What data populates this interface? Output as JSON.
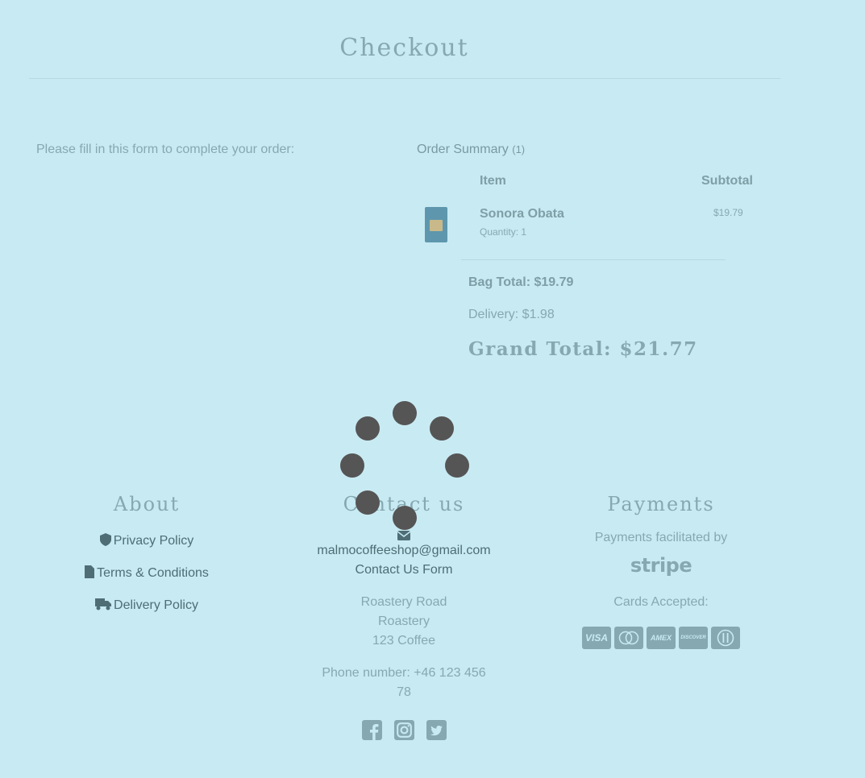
{
  "page": {
    "title": "Checkout"
  },
  "form": {
    "intro": "Please fill in this form to complete your order:"
  },
  "summary": {
    "heading": "Order Summary",
    "count": "(1)",
    "col_item": "Item",
    "col_subtotal": "Subtotal",
    "items": [
      {
        "name": "Sonora Obata",
        "quantity": "Quantity: 1",
        "price": "$19.79"
      }
    ],
    "bag_total": "Bag Total: $19.79",
    "delivery": "Delivery: $1.98",
    "grand_total": "Grand Total: $21.77"
  },
  "footer": {
    "about": {
      "heading": "About",
      "links": [
        "Privacy Policy",
        "Terms & Conditions",
        "Delivery Policy"
      ]
    },
    "contact": {
      "heading": "Contact us",
      "email": "malmocoffeeshop@gmail.com",
      "form_link": "Contact Us Form",
      "address": [
        "Roastery Road",
        "Roastery",
        "123 Coffee"
      ],
      "phone_line1": "Phone number: +46 123 456",
      "phone_line2": "78"
    },
    "payments": {
      "heading": "Payments",
      "facilitated": "Payments facilitated by",
      "provider": "stripe",
      "cards_label": "Cards Accepted:",
      "cards": [
        "VISA",
        "MC",
        "AMEX",
        "DISCOVER",
        "DINERS"
      ]
    }
  },
  "icons": [
    "shield-icon",
    "file-icon",
    "truck-icon",
    "envelope-icon",
    "facebook-icon",
    "instagram-icon",
    "twitter-icon"
  ],
  "colors": {
    "background": "#c8eaf3",
    "text": "#86a9b1",
    "link": "#4e6d75",
    "spinner": "#555555"
  }
}
